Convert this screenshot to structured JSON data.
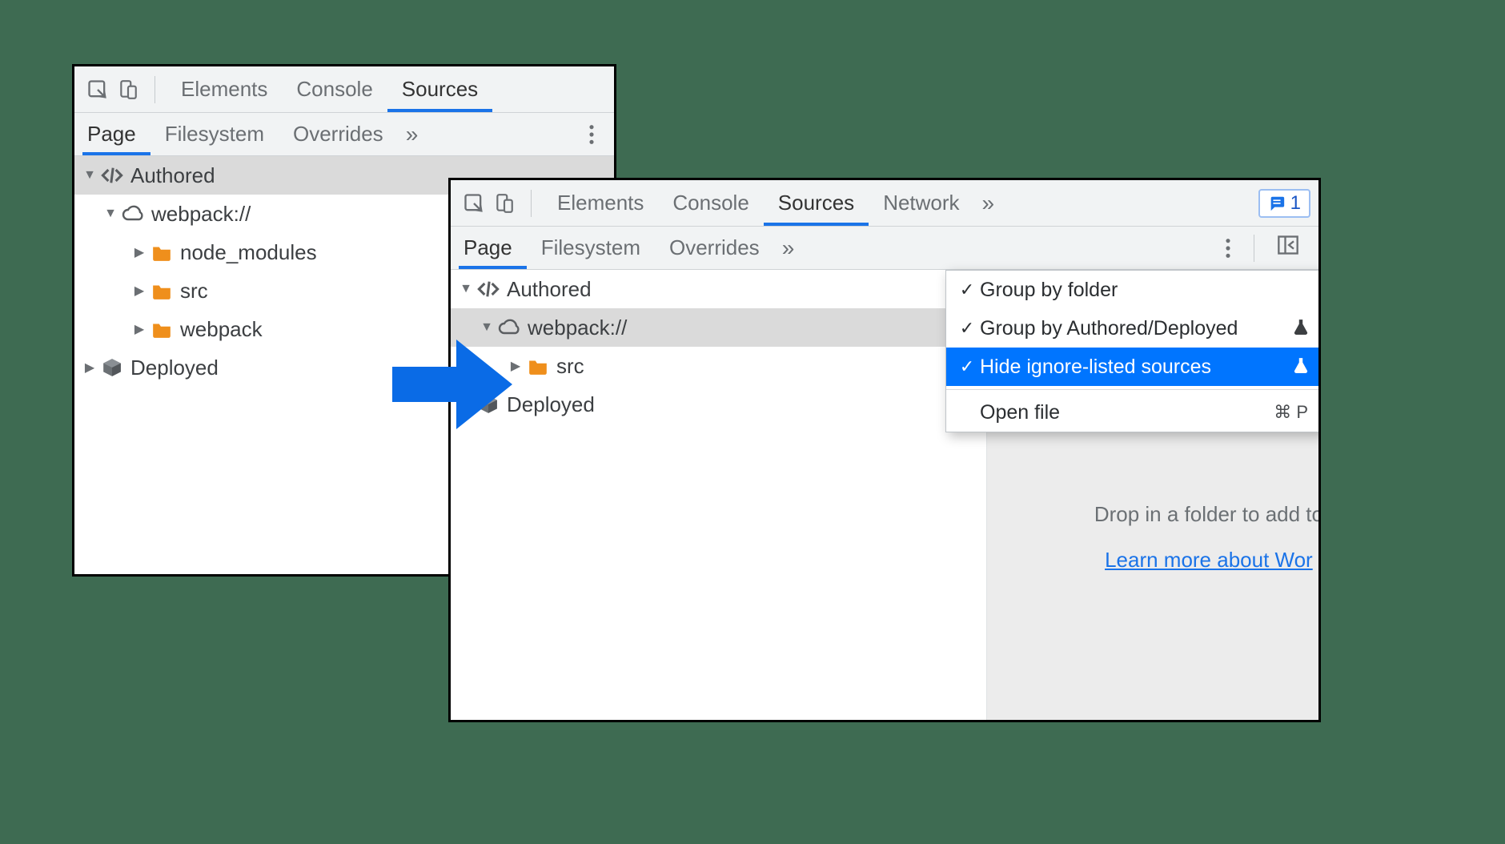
{
  "tabs": {
    "elements": "Elements",
    "console": "Console",
    "sources": "Sources",
    "network": "Network"
  },
  "subtabs": {
    "page": "Page",
    "filesystem": "Filesystem",
    "overrides": "Overrides"
  },
  "tree_left": {
    "authored": "Authored",
    "webpack": "webpack://",
    "node_modules": "node_modules",
    "src": "src",
    "webpack_folder": "webpack",
    "deployed": "Deployed"
  },
  "tree_right": {
    "authored": "Authored",
    "webpack": "webpack://",
    "src": "src",
    "deployed": "Deployed"
  },
  "issues_count": "1",
  "context_menu": {
    "group_by_folder": "Group by folder",
    "group_by_authored": "Group by Authored/Deployed",
    "hide_ignore_listed": "Hide ignore-listed sources",
    "open_file": "Open file",
    "open_file_shortcut": "⌘ P"
  },
  "right_hint": {
    "line1": "Drop in a folder to add to",
    "link": "Learn more about Wor"
  }
}
